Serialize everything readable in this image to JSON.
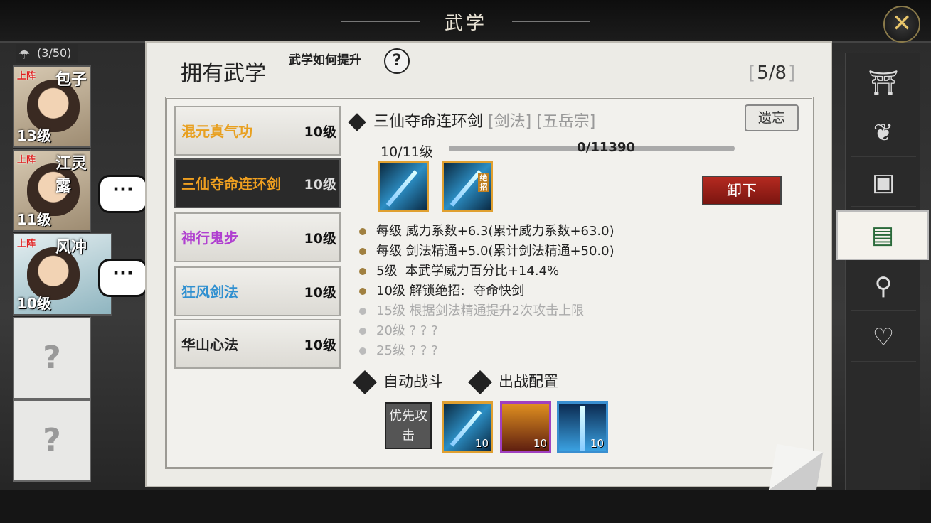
{
  "header": {
    "title": "武学"
  },
  "party_count": "(3/50)",
  "heroes": [
    {
      "tag": "上阵",
      "name": "包子",
      "level": "13级"
    },
    {
      "tag": "上阵",
      "name": "江灵露",
      "level": "11级"
    },
    {
      "tag": "上阵",
      "name": "风冲",
      "level": "10级"
    },
    {
      "placeholder": "?"
    },
    {
      "placeholder": "?"
    }
  ],
  "chat_bubble": "···",
  "panel": {
    "heading": "拥有武学",
    "howto": "武学如何提升",
    "howto_icon": "?",
    "page": "5/8"
  },
  "skills": [
    {
      "name": "混元真气功",
      "level": "10级",
      "color": "#e8a020"
    },
    {
      "name": "三仙夺命连环剑",
      "level": "10级",
      "color": "#f0a020"
    },
    {
      "name": "神行鬼步",
      "level": "10级",
      "color": "#b040d0"
    },
    {
      "name": "狂风剑法",
      "level": "10级",
      "color": "#3090d0"
    },
    {
      "name": "华山心法",
      "level": "10级",
      "color": "#e8e8e8"
    }
  ],
  "detail": {
    "name": "三仙夺命连环剑",
    "type_tag": "[剑法]",
    "sect_tag": "[五岳宗]",
    "forget": "遗忘",
    "level": "10/11级",
    "exp": "0/11390",
    "ultimate_badge": "绝招",
    "unequip": "卸下",
    "attributes": [
      {
        "text": "每级 威力系数+6.3(累计威力系数+63.0)",
        "unlocked": true
      },
      {
        "text": "每级 剑法精通+5.0(累计剑法精通+50.0)",
        "unlocked": true
      },
      {
        "text": "5级  本武学威力百分比+14.4%",
        "unlocked": true
      },
      {
        "text": "10级 解锁绝招:  夺命快剑",
        "unlocked": true
      },
      {
        "text": "15级 根据剑法精通提升2次攻击上限",
        "unlocked": false
      },
      {
        "text": "20级 ? ? ?",
        "unlocked": false
      },
      {
        "text": "25级 ? ? ?",
        "unlocked": false
      }
    ],
    "auto_battle": "自动战斗",
    "battle_config": "出战配置",
    "priority": "优先攻击",
    "slots": [
      {
        "level": "10"
      },
      {
        "level": "10"
      },
      {
        "level": "10"
      }
    ]
  },
  "rail_icons": [
    "formation-icon",
    "herb-icon",
    "gift-box-icon",
    "skill-book-icon",
    "meridian-icon",
    "heart-icon"
  ]
}
